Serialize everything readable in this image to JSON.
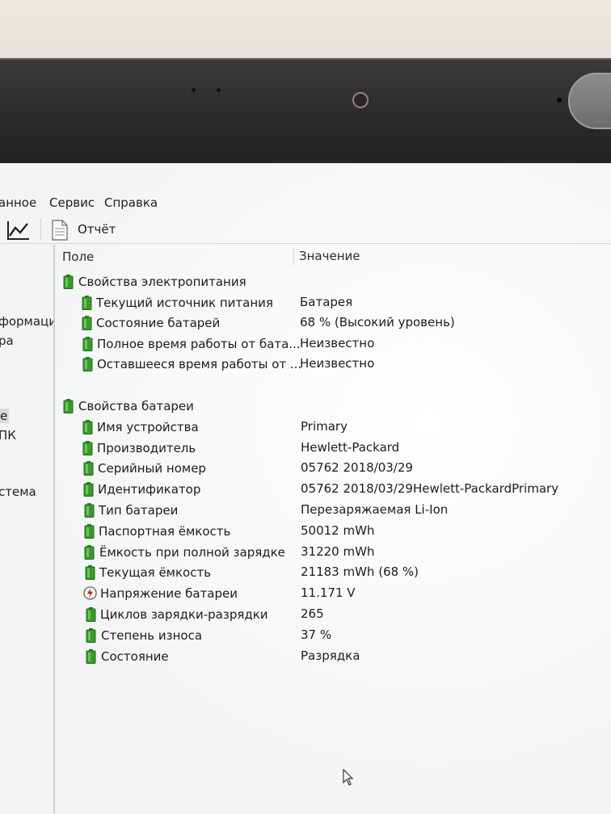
{
  "menu": {
    "partial_item": "анное",
    "items": [
      "Сервис",
      "Справка"
    ]
  },
  "toolbar": {
    "report_label": "Отчёт"
  },
  "left_panel": {
    "fragments": [
      "формаци",
      "ра",
      "е",
      "ПК",
      "стема"
    ]
  },
  "columns": {
    "field": "Поле",
    "value": "Значение"
  },
  "power_group": {
    "title": "Свойства электропитания",
    "items": [
      {
        "name": "Текущий источник питания",
        "value": "Батарея"
      },
      {
        "name": "Состояние батарей",
        "value": "68 % (Высокий уровень)"
      },
      {
        "name": "Полное время работы от бата...",
        "value": "Неизвестно"
      },
      {
        "name": "Оставшееся время работы от ...",
        "value": "Неизвестно"
      }
    ]
  },
  "battery_group": {
    "title": "Свойства батареи",
    "items": [
      {
        "name": "Имя устройства",
        "value": "Primary",
        "icon": "battery-icon"
      },
      {
        "name": "Производитель",
        "value": "Hewlett-Packard",
        "icon": "battery-icon"
      },
      {
        "name": "Серийный номер",
        "value": "05762 2018/03/29",
        "icon": "battery-icon"
      },
      {
        "name": "Идентификатор",
        "value": "05762 2018/03/29Hewlett-PackardPrimary",
        "icon": "battery-icon"
      },
      {
        "name": "Тип батареи",
        "value": "Перезаряжаемая Li-Ion",
        "icon": "battery-icon"
      },
      {
        "name": "Паспортная ёмкость",
        "value": "50012 mWh",
        "icon": "battery-icon"
      },
      {
        "name": "Ёмкость при полной зарядке",
        "value": "31220 mWh",
        "icon": "battery-icon"
      },
      {
        "name": "Текущая ёмкость",
        "value": "21183 mWh  (68 %)",
        "icon": "battery-icon"
      },
      {
        "name": "Напряжение батареи",
        "value": "11.171 V",
        "icon": "voltage-icon"
      },
      {
        "name": "Циклов зарядки-разрядки",
        "value": "265",
        "icon": "battery-icon"
      },
      {
        "name": "Степень износа",
        "value": "37 %",
        "icon": "battery-icon"
      },
      {
        "name": "Состояние",
        "value": "Разрядка",
        "icon": "battery-icon"
      }
    ]
  },
  "colors": {
    "battery_green": "#3a9a2c",
    "voltage_red": "#c4281c"
  }
}
